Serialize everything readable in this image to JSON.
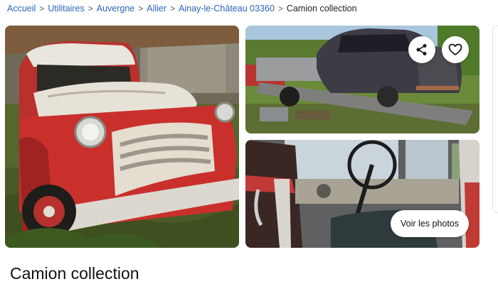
{
  "breadcrumb": {
    "items": [
      {
        "label": "Accueil"
      },
      {
        "label": "Utilitaires"
      },
      {
        "label": "Auvergne"
      },
      {
        "label": "Allier"
      },
      {
        "label": "Ainay-le-Château 03360"
      }
    ],
    "separator": ">",
    "current": "Camion collection"
  },
  "gallery": {
    "main_photo": {
      "subject": "red vintage truck with white hood in overgrown yard"
    },
    "top_photo": {
      "subject": "old dark car loaded on a trailer"
    },
    "bottom_photo": {
      "subject": "truck cab interior with steering wheel"
    },
    "share_icon": "share-icon",
    "favorite_icon": "heart-icon",
    "see_photos_label": "Voir les photos"
  },
  "listing": {
    "title": "Camion collection"
  },
  "colors": {
    "link": "#2a64b8",
    "truck_red": "#c9302c",
    "text": "#111111"
  }
}
